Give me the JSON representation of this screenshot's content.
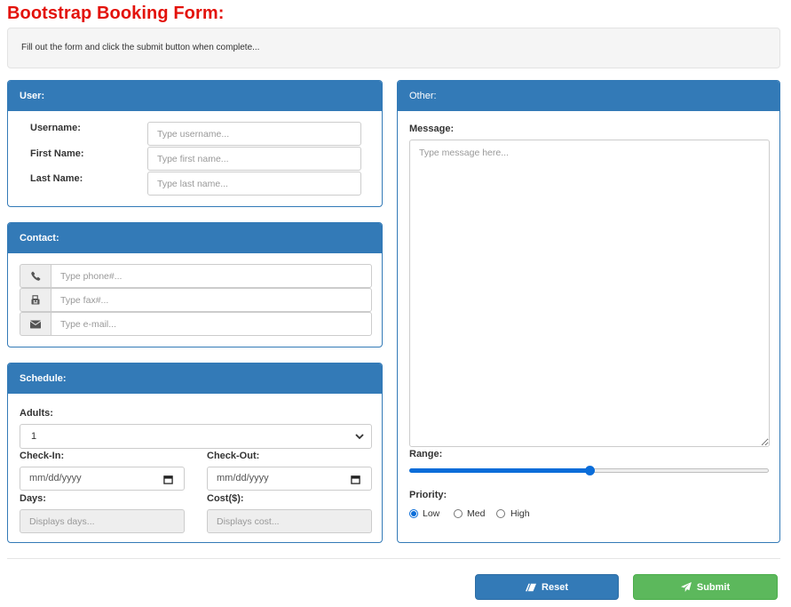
{
  "page": {
    "title": "Bootstrap Booking Form:",
    "instructions": "Fill out the form and click the submit button when complete..."
  },
  "user_panel": {
    "heading": "User:",
    "username_label": "Username:",
    "username_placeholder": "Type username...",
    "firstname_label": "First Name:",
    "firstname_placeholder": "Type first name...",
    "lastname_label": "Last Name:",
    "lastname_placeholder": "Type last name..."
  },
  "contact_panel": {
    "heading": "Contact:",
    "phone_icon": "phone-icon",
    "phone_placeholder": "Type phone#...",
    "fax_icon": "fax-icon",
    "fax_placeholder": "Type fax#...",
    "email_icon": "envelope-icon",
    "email_placeholder": "Type e-mail..."
  },
  "schedule_panel": {
    "heading": "Schedule:",
    "adults_label": "Adults:",
    "adults_value": "1",
    "checkin_label": "Check-In:",
    "checkin_value": "mm/dd/yyyy",
    "checkout_label": "Check-Out:",
    "checkout_value": "mm/dd/yyyy",
    "days_label": "Days:",
    "days_placeholder": "Displays days...",
    "cost_label": "Cost($):",
    "cost_placeholder": "Displays cost..."
  },
  "other_panel": {
    "heading": "Other:",
    "message_label": "Message:",
    "message_placeholder": "Type message here...",
    "range_label": "Range:",
    "range_value_fraction": 0.5,
    "priority_label": "Priority:",
    "priority_options": [
      "Low",
      "Med",
      "High"
    ],
    "priority_selected": "Low"
  },
  "actions": {
    "reset_label": "Reset",
    "submit_label": "Submit"
  },
  "colors": {
    "title": "#e3120b",
    "panel_primary": "#337ab7",
    "success": "#5cb85c",
    "accent": "#0a6dd9"
  }
}
